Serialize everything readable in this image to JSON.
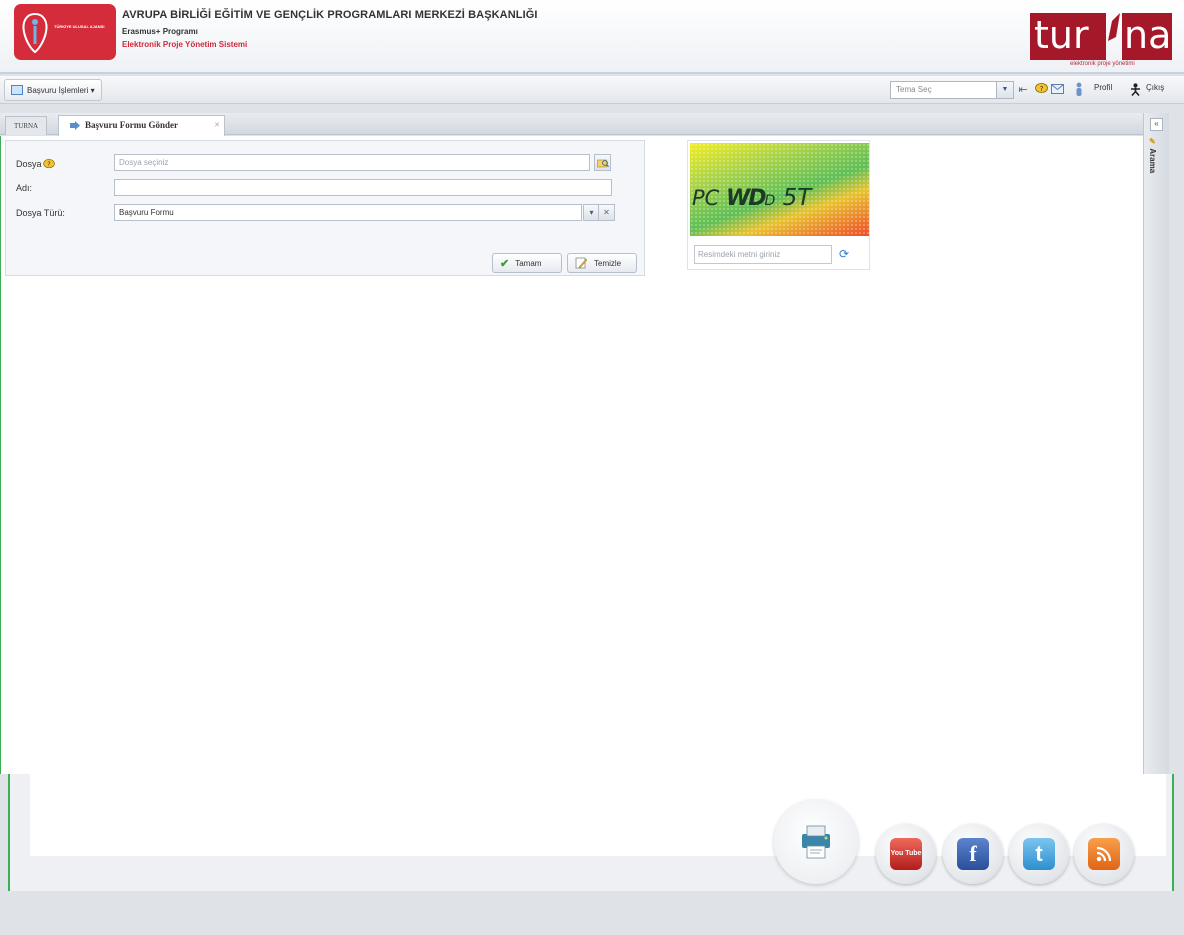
{
  "header": {
    "agency_logo_text": "TÜRKİYE ULUSAL AJANSI",
    "title": "AVRUPA BİRLİĞİ EĞİTİM VE GENÇLİK PROGRAMLARI MERKEZİ BAŞKANLIĞI",
    "program": "Erasmus+ Programı",
    "system": "Elektronik Proje Yönetim Sistemi",
    "turna_logo_left": "tur",
    "turna_logo_right": "na",
    "turna_tagline": "elektronik proje yönetimi"
  },
  "toolbar": {
    "menu_label": "Başvuru İşlemleri ▾",
    "theme_placeholder": "Tema Seç",
    "profile_label": "Profil",
    "logout_label": "Çıkış"
  },
  "tabs": {
    "home": "TURNA",
    "active": "Başvuru Formu Gönder"
  },
  "form": {
    "file_label": "Dosya",
    "file_placeholder": "Dosya seçiniz",
    "name_label": "Adı:",
    "name_value": "",
    "type_label": "Dosya Türü:",
    "type_value": "Başvuru Formu",
    "ok_label": "Tamam",
    "clear_label": "Temizle"
  },
  "captcha": {
    "text_prefix": "PC ",
    "text_a": "WD",
    "text_b": "D",
    "text_c": " 5T",
    "input_placeholder": "Resimdeki metni giriniz"
  },
  "sidebar": {
    "label": "Arama"
  },
  "footer": {
    "youtube_label": "You Tube",
    "facebook_label": "f",
    "twitter_label": "t"
  },
  "colors": {
    "brand_red": "#a5182a",
    "agency_red": "#d42c3a",
    "accent_green": "#3cae55"
  }
}
